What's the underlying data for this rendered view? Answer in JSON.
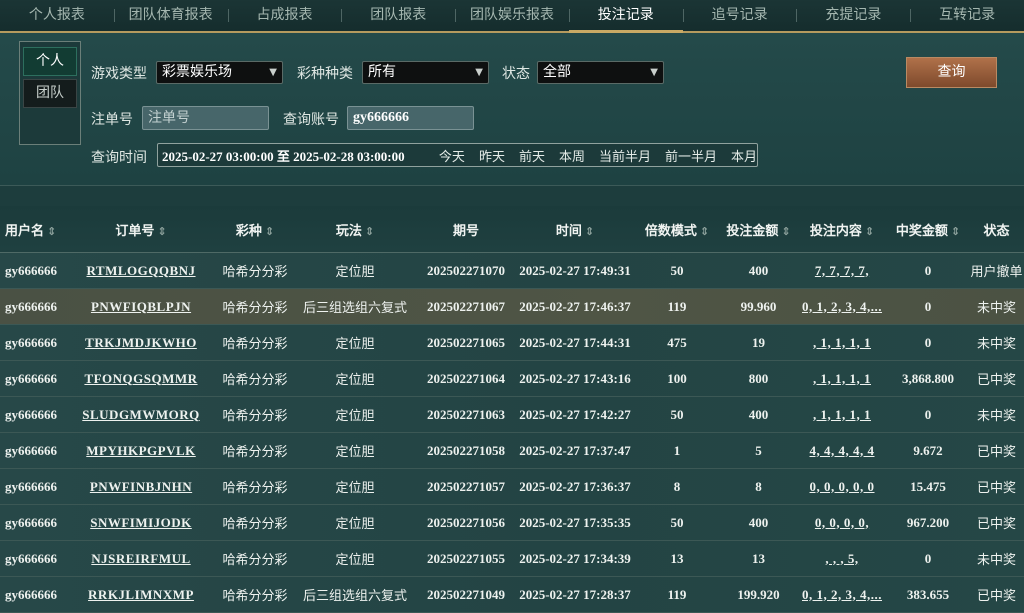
{
  "tabs": [
    "个人报表",
    "团队体育报表",
    "占成报表",
    "团队报表",
    "团队娱乐报表",
    "投注记录",
    "追号记录",
    "充提记录",
    "互转记录"
  ],
  "active_tab": 5,
  "scope": {
    "personal": "个人",
    "team": "团队"
  },
  "filters": {
    "game_type_label": "游戏类型",
    "game_type_value": "彩票娱乐场",
    "lottery_kind_label": "彩种种类",
    "lottery_kind_value": "所有",
    "status_label": "状态",
    "status_value": "全部",
    "order_no_label": "注单号",
    "order_no_placeholder": "注单号",
    "account_label": "查询账号",
    "account_value": "gy666666",
    "time_label": "查询时间",
    "time_range": "2025-02-27 03:00:00 至 2025-02-28 03:00:00",
    "quick_ranges": [
      "今天",
      "昨天",
      "前天",
      "本周",
      "当前半月",
      "前一半月",
      "本月"
    ],
    "query_button": "查询"
  },
  "columns": [
    "用户名",
    "订单号",
    "彩种",
    "玩法",
    "期号",
    "时间",
    "倍数模式",
    "投注金额",
    "投注内容",
    "中奖金额",
    "状态"
  ],
  "sortable": [
    true,
    true,
    true,
    true,
    false,
    true,
    true,
    true,
    true,
    true,
    false
  ],
  "rows": [
    [
      "gy666666",
      "RTMLOGQQBNJ",
      "哈希分分彩",
      "定位胆",
      "202502271070",
      "2025-02-27 17:49:31",
      "50",
      "400",
      "7, 7, 7, 7,",
      "0",
      "用户撤单"
    ],
    [
      "gy666666",
      "PNWFIQBLPJN",
      "哈希分分彩",
      "后三组选组六复式",
      "202502271067",
      "2025-02-27 17:46:37",
      "119",
      "99.960",
      "0, 1, 2, 3, 4,...",
      "0",
      "未中奖"
    ],
    [
      "gy666666",
      "TRKJMDJKWHO",
      "哈希分分彩",
      "定位胆",
      "202502271065",
      "2025-02-27 17:44:31",
      "475",
      "19",
      ", 1, 1, 1, 1",
      "0",
      "未中奖"
    ],
    [
      "gy666666",
      "TFONQGSQMMR",
      "哈希分分彩",
      "定位胆",
      "202502271064",
      "2025-02-27 17:43:16",
      "100",
      "800",
      ", 1, 1, 1, 1",
      "3,868.800",
      "已中奖"
    ],
    [
      "gy666666",
      "SLUDGMWMORQ",
      "哈希分分彩",
      "定位胆",
      "202502271063",
      "2025-02-27 17:42:27",
      "50",
      "400",
      ", 1, 1, 1, 1",
      "0",
      "未中奖"
    ],
    [
      "gy666666",
      "MPYHKPGPVLK",
      "哈希分分彩",
      "定位胆",
      "202502271058",
      "2025-02-27 17:37:47",
      "1",
      "5",
      "4, 4, 4, 4, 4",
      "9.672",
      "已中奖"
    ],
    [
      "gy666666",
      "PNWFINBJNHN",
      "哈希分分彩",
      "定位胆",
      "202502271057",
      "2025-02-27 17:36:37",
      "8",
      "8",
      "0, 0, 0, 0, 0",
      "15.475",
      "已中奖"
    ],
    [
      "gy666666",
      "SNWFIMIJODK",
      "哈希分分彩",
      "定位胆",
      "202502271056",
      "2025-02-27 17:35:35",
      "50",
      "400",
      "0, 0, 0, 0,",
      "967.200",
      "已中奖"
    ],
    [
      "gy666666",
      "NJSREIRFMUL",
      "哈希分分彩",
      "定位胆",
      "202502271055",
      "2025-02-27 17:34:39",
      "13",
      "13",
      ", , , 5,",
      "0",
      "未中奖"
    ],
    [
      "gy666666",
      "RRKJLIMNXMP",
      "哈希分分彩",
      "后三组选组六复式",
      "202502271049",
      "2025-02-27 17:28:37",
      "119",
      "199.920",
      "0, 1, 2, 3, 4,...",
      "383.655",
      "已中奖"
    ]
  ],
  "highlight_row": 1,
  "icons": {
    "sort": "sort-arrows-icon",
    "dropdown": "chevron-down-icon"
  }
}
